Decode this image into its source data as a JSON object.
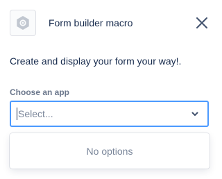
{
  "header": {
    "app_icon": "gear-hexagon-icon",
    "title": "Form builder macro",
    "close_icon": "close-icon"
  },
  "description": "Create and display your form your way!.",
  "app_select": {
    "label": "Choose an app",
    "placeholder": "Select...",
    "value": "",
    "chevron_icon": "chevron-down-icon"
  },
  "menu": {
    "no_options_text": "No options"
  },
  "colors": {
    "focus_border": "#4c9aff",
    "text": "#172b4d",
    "muted": "#6b778c",
    "placeholder": "#7a869a"
  }
}
